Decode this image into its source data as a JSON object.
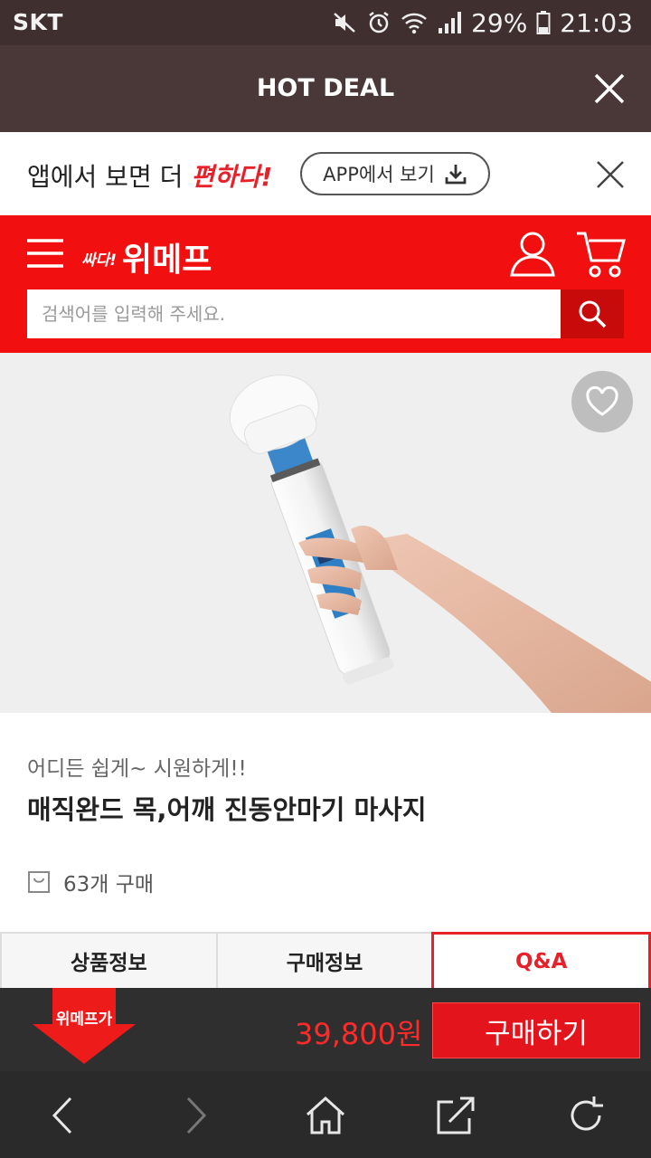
{
  "status_bar": {
    "carrier": "SKT",
    "battery": "29%",
    "time": "21:03"
  },
  "hot_deal": {
    "title": "HOT DEAL"
  },
  "app_banner": {
    "promo_prefix": "앱에서 보면 더 ",
    "promo_highlight": "편하다!",
    "app_button_label": "APP에서 보기"
  },
  "header": {
    "logo_small": "싸다!",
    "logo_big": "위메프"
  },
  "search": {
    "placeholder": "검색어를 입력해 주세요."
  },
  "product": {
    "subtitle": "어디든 쉽게~ 시원하게!!",
    "title": "매직완드 목,어깨 진동안마기 마사지",
    "purchase_count": "63개 구매"
  },
  "tabs": [
    {
      "label": "상품정보",
      "active": false
    },
    {
      "label": "구매정보",
      "active": false
    },
    {
      "label": "Q&A",
      "active": true
    }
  ],
  "buy_bar": {
    "badge": "위메프가",
    "price": "39,800원",
    "buy_label": "구매하기"
  },
  "colors": {
    "brand_red": "#f20f0f",
    "accent_red": "#e8202a",
    "hotdeal_bg": "#4a3838"
  },
  "icons": [
    "mute-icon",
    "alarm-icon",
    "wifi-icon",
    "signal-icon",
    "battery-icon",
    "close-icon",
    "download-icon",
    "menu-icon",
    "user-icon",
    "cart-icon",
    "search-icon",
    "heart-icon",
    "bag-icon",
    "back-icon",
    "forward-icon",
    "home-icon",
    "share-icon",
    "refresh-icon"
  ]
}
